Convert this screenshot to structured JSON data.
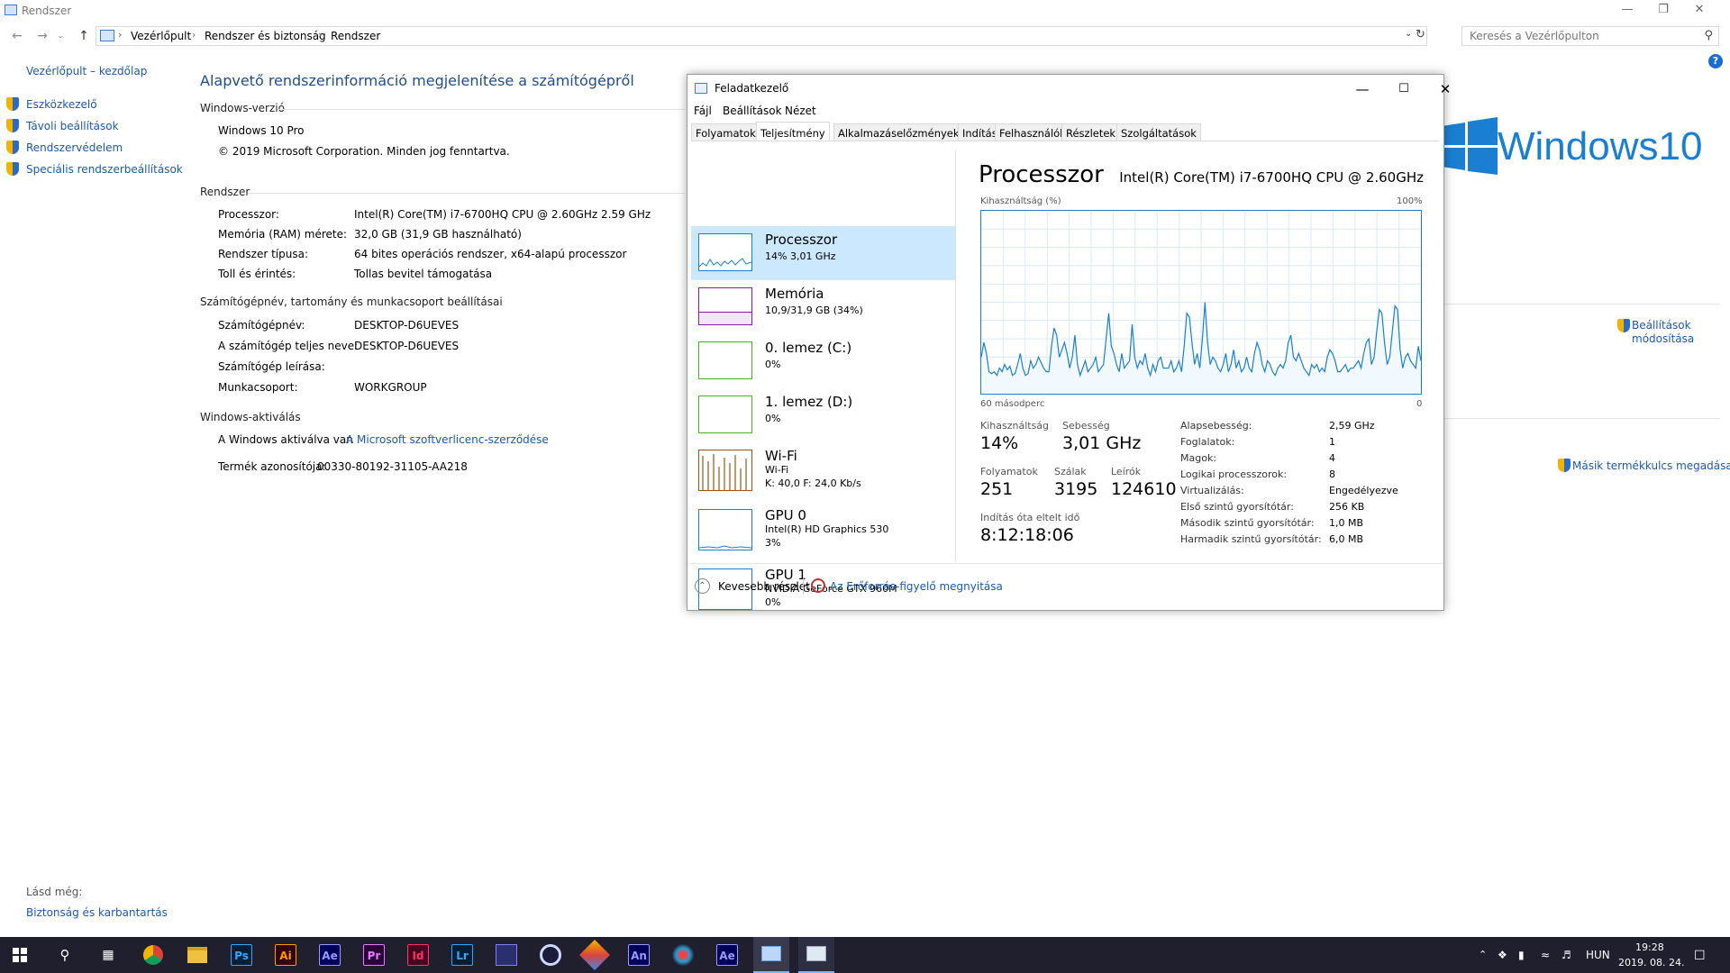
{
  "window": {
    "title": "Rendszer",
    "breadcrumb": [
      "Vezérlőpult",
      "Rendszer és biztonság",
      "Rendszer"
    ],
    "search_placeholder": "Keresés a Vezérlőpulton"
  },
  "sidebar": {
    "home": "Vezérlőpult – kezdőlap",
    "items": [
      {
        "label": "Eszközkezelő"
      },
      {
        "label": "Távoli beállítások"
      },
      {
        "label": "Rendszervédelem"
      },
      {
        "label": "Speciális rendszerbeállítások"
      }
    ],
    "see_also": "Lásd még:",
    "security_link": "Biztonság és karbantartás"
  },
  "main": {
    "heading": "Alapvető rendszerinformáció megjelenítése a számítógépről",
    "edition_section": "Windows-verzió",
    "edition": "Windows 10 Pro",
    "copyright": "© 2019 Microsoft Corporation. Minden jog fenntartva.",
    "system_section": "Rendszer",
    "system": [
      {
        "label": "Processzor:",
        "value": "Intel(R) Core(TM) i7-6700HQ CPU @ 2.60GHz   2.59 GHz"
      },
      {
        "label": "Memória (RAM) mérete:",
        "value": "32,0 GB (31,9 GB használható)"
      },
      {
        "label": "Rendszer típusa:",
        "value": "64 bites operációs rendszer, x64-alapú processzor"
      },
      {
        "label": "Toll és érintés:",
        "value": "Tollas bevitel támogatása"
      }
    ],
    "computer_section": "Számítógépnév, tartomány és munkacsoport beállításai",
    "computer": [
      {
        "label": "Számítógépnév:",
        "value": "DESKTOP-D6UEVES"
      },
      {
        "label": "A számítógép teljes neve:",
        "value": "DESKTOP-D6UEVES"
      },
      {
        "label": "Számítógép leírása:",
        "value": ""
      },
      {
        "label": "Munkacsoport:",
        "value": "WORKGROUP"
      }
    ],
    "change_settings": "Beállítások módosítása",
    "activation_section": "Windows-aktiválás",
    "activated_text": "A Windows aktiválva van",
    "license_link": "A Microsoft szoftverlicenc-szerződése",
    "product_id_label": "Termék azonosítója:",
    "product_id": "00330-80192-31105-AA218",
    "change_key": "Másik termékkulcs megadása",
    "logo_text": "Windows10"
  },
  "taskmgr": {
    "title": "Feladatkezelő",
    "menu": [
      "Fájl",
      "Beállítások",
      "Nézet"
    ],
    "tabs": [
      "Folyamatok",
      "Teljesítmény",
      "Alkalmazáselőzmények",
      "Indítás",
      "Felhasználók",
      "Részletek",
      "Szolgáltatások"
    ],
    "active_tab": "Teljesítmény",
    "resources": [
      {
        "name": "Processzor",
        "sub1": "14%  3,01 GHz",
        "sub2": "",
        "sub3": "",
        "color": "#1a7fd0"
      },
      {
        "name": "Memória",
        "sub1": "10,9/31,9 GB (34%)",
        "sub2": "",
        "sub3": "",
        "color": "#8b1aa8"
      },
      {
        "name": "0. lemez (C:)",
        "sub1": "0%",
        "sub2": "",
        "sub3": "",
        "color": "#4caf20"
      },
      {
        "name": "1. lemez (D:)",
        "sub1": "0%",
        "sub2": "",
        "sub3": "",
        "color": "#4caf20"
      },
      {
        "name": "Wi-Fi",
        "sub1": "Wi-Fi",
        "sub2": "K: 40,0  F: 24,0 Kb/s",
        "sub3": "",
        "color": "#a0520c"
      },
      {
        "name": "GPU 0",
        "sub1": "Intel(R) HD Graphics 530",
        "sub2": "3%",
        "sub3": "",
        "color": "#1a7fd0"
      },
      {
        "name": "GPU 1",
        "sub1": "NVIDIA GeForce GTX 960M",
        "sub2": "0%",
        "sub3": "",
        "color": "#1a7fd0"
      }
    ],
    "detail_title": "Processzor",
    "cpu_model": "Intel(R) Core(TM) i7-6700HQ CPU @ 2.60GHz",
    "graph_label": "Kihasználtság (%)",
    "graph_max": "100%",
    "graph_time": "60 másodperc",
    "graph_min": "0",
    "cpu_history": [
      20,
      28,
      22,
      12,
      11,
      12,
      10,
      14,
      12,
      16,
      13,
      15,
      10,
      11,
      16,
      22,
      14,
      10,
      11,
      18,
      14,
      16,
      20,
      17,
      14,
      12,
      12,
      26,
      36,
      32,
      20,
      24,
      28,
      22,
      14,
      20,
      32,
      16,
      10,
      14,
      18,
      12,
      14,
      16,
      20,
      12,
      14,
      16,
      30,
      44,
      26,
      22,
      16,
      12,
      22,
      14,
      16,
      18,
      38,
      20,
      14,
      18,
      16,
      22,
      14,
      10,
      16,
      12,
      18,
      20,
      14,
      14,
      14,
      18,
      12,
      14,
      18,
      12,
      26,
      44,
      42,
      28,
      16,
      22,
      14,
      30,
      50,
      28,
      16,
      20,
      18,
      14,
      12,
      16,
      22,
      12,
      16,
      24,
      14,
      18,
      12,
      14,
      20,
      14,
      12,
      22,
      28,
      24,
      16,
      12,
      18,
      16,
      12,
      10,
      14,
      16,
      14,
      18,
      28,
      32,
      20,
      18,
      22,
      18,
      14,
      12,
      10,
      16,
      14,
      16,
      12,
      14,
      12,
      20,
      24,
      22,
      18,
      12,
      12,
      14,
      16,
      12,
      14,
      14,
      16,
      18,
      14,
      22,
      28,
      30,
      16,
      20,
      34,
      46,
      44,
      28,
      16,
      20,
      34,
      48,
      46,
      24,
      14,
      20,
      22,
      18,
      16,
      14,
      26,
      18
    ],
    "stats": {
      "util_label": "Kihasználtság",
      "util": "14%",
      "speed_label": "Sebesség",
      "speed": "3,01 GHz",
      "proc_label": "Folyamatok",
      "proc": "251",
      "threads_label": "Szálak",
      "threads": "3195",
      "handles_label": "Leírók",
      "handles": "124610",
      "uptime_label": "Indítás óta eltelt idő",
      "uptime": "8:12:18:06"
    },
    "specs": [
      {
        "label": "Alapsebesség:",
        "value": "2,59 GHz"
      },
      {
        "label": "Foglalatok:",
        "value": "1"
      },
      {
        "label": "Magok:",
        "value": "4"
      },
      {
        "label": "Logikai processzorok:",
        "value": "8"
      },
      {
        "label": "Virtualizálás:",
        "value": "Engedélyezve"
      },
      {
        "label": "Első szintű gyorsítótár:",
        "value": "256 KB"
      },
      {
        "label": "Második szintű gyorsítótár:",
        "value": "1,0 MB"
      },
      {
        "label": "Harmadik szintű gyorsítótár:",
        "value": "6,0 MB"
      }
    ],
    "fewer_details": "Kevesebb részlet",
    "open_monitor": "Az Erőforrás-figyelő megnyitása"
  },
  "taskbar": {
    "apps": [
      {
        "label": "Ps",
        "icon": "photoshop-icon",
        "fg": "#31a8ff",
        "bg": "#001e36"
      },
      {
        "label": "Ai",
        "icon": "illustrator-icon",
        "fg": "#ff9a00",
        "bg": "#330000"
      },
      {
        "label": "Ae",
        "icon": "after-effects-icon",
        "fg": "#9999ff",
        "bg": "#00005b"
      },
      {
        "label": "Pr",
        "icon": "premiere-icon",
        "fg": "#ea77ff",
        "bg": "#2a0038"
      },
      {
        "label": "Id",
        "icon": "indesign-icon",
        "fg": "#ff3366",
        "bg": "#49021f"
      },
      {
        "label": "Lr",
        "icon": "lightroom-icon",
        "fg": "#31a8ff",
        "bg": "#001e36"
      },
      {
        "label": "An",
        "icon": "animate-icon",
        "fg": "#9999ff",
        "bg": "#00005b"
      },
      {
        "label": "Ae",
        "icon": "after-effects-icon-2",
        "fg": "#9999ff",
        "bg": "#00005b"
      }
    ],
    "language": "HUN",
    "time": "19:28",
    "date": "2019. 08. 24."
  }
}
